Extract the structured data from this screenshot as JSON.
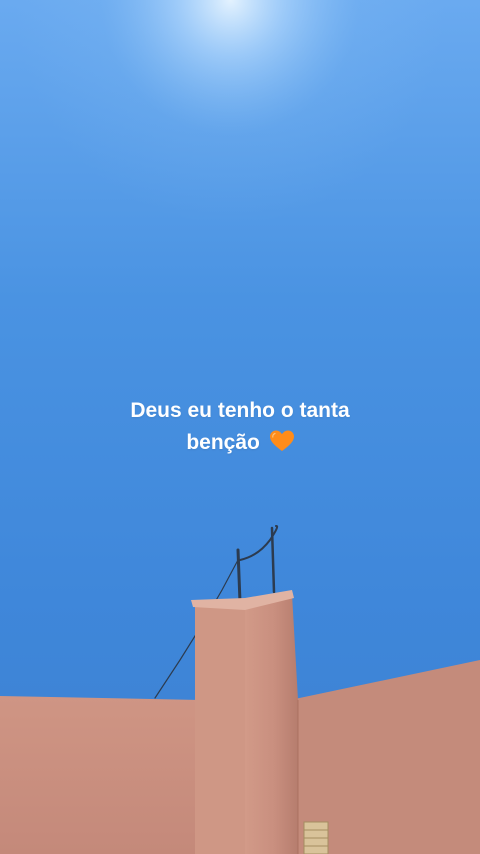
{
  "story": {
    "caption_line1": "Deus eu tenho  o tanta",
    "caption_line2": "benção",
    "emoji": "orange-heart-icon"
  },
  "colors": {
    "sky_top": "#5fa3ec",
    "sky_mid": "#3f88dc",
    "sky_bottom": "#3a7fd0",
    "wall": "#c88d7c",
    "wall_shadow": "#a86f62",
    "heart": "#ff8c1a",
    "caption": "#ffffff"
  }
}
